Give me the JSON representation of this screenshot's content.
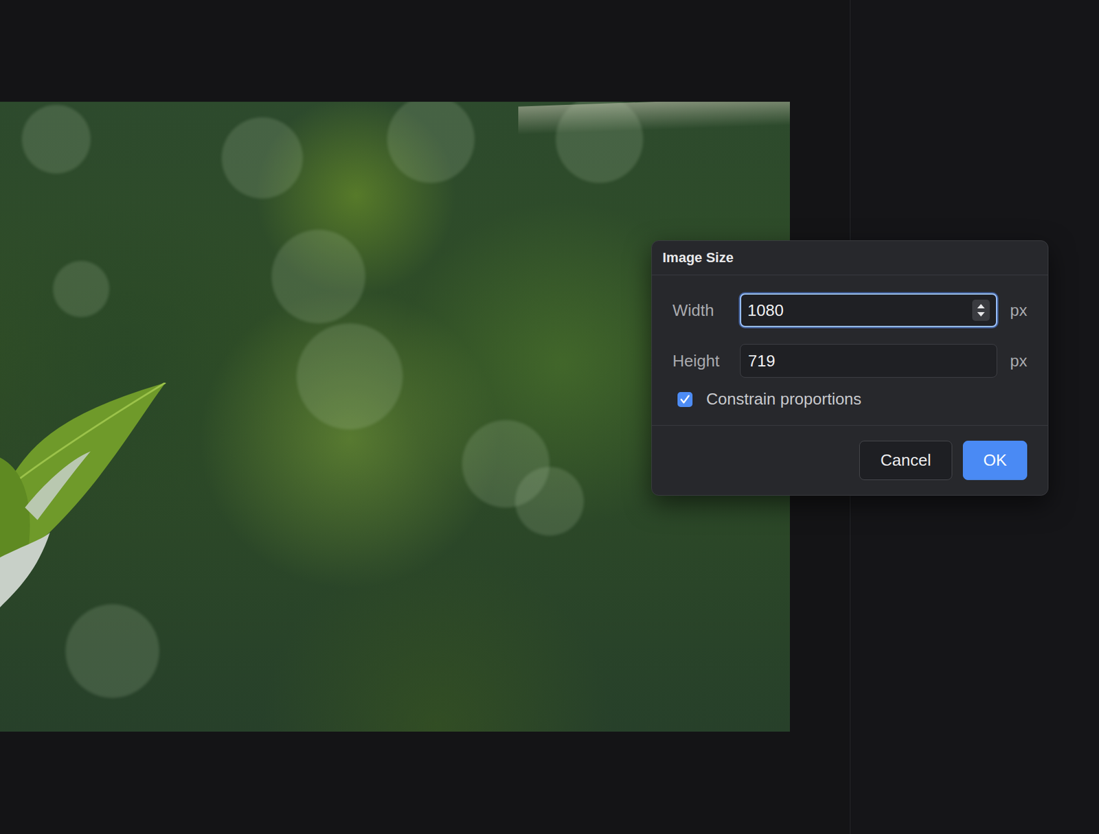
{
  "dialog": {
    "title": "Image Size"
  },
  "fields": [
    {
      "label": "Width",
      "value": "1080",
      "unit": "px",
      "focused": true
    },
    {
      "label": "Height",
      "value": "719",
      "unit": "px",
      "focused": false
    }
  ],
  "constrain": {
    "label": "Constrain proportions",
    "checked": true
  },
  "buttons": [
    {
      "label": "Cancel",
      "kind": "secondary"
    },
    {
      "label": "OK",
      "kind": "primary"
    }
  ]
}
